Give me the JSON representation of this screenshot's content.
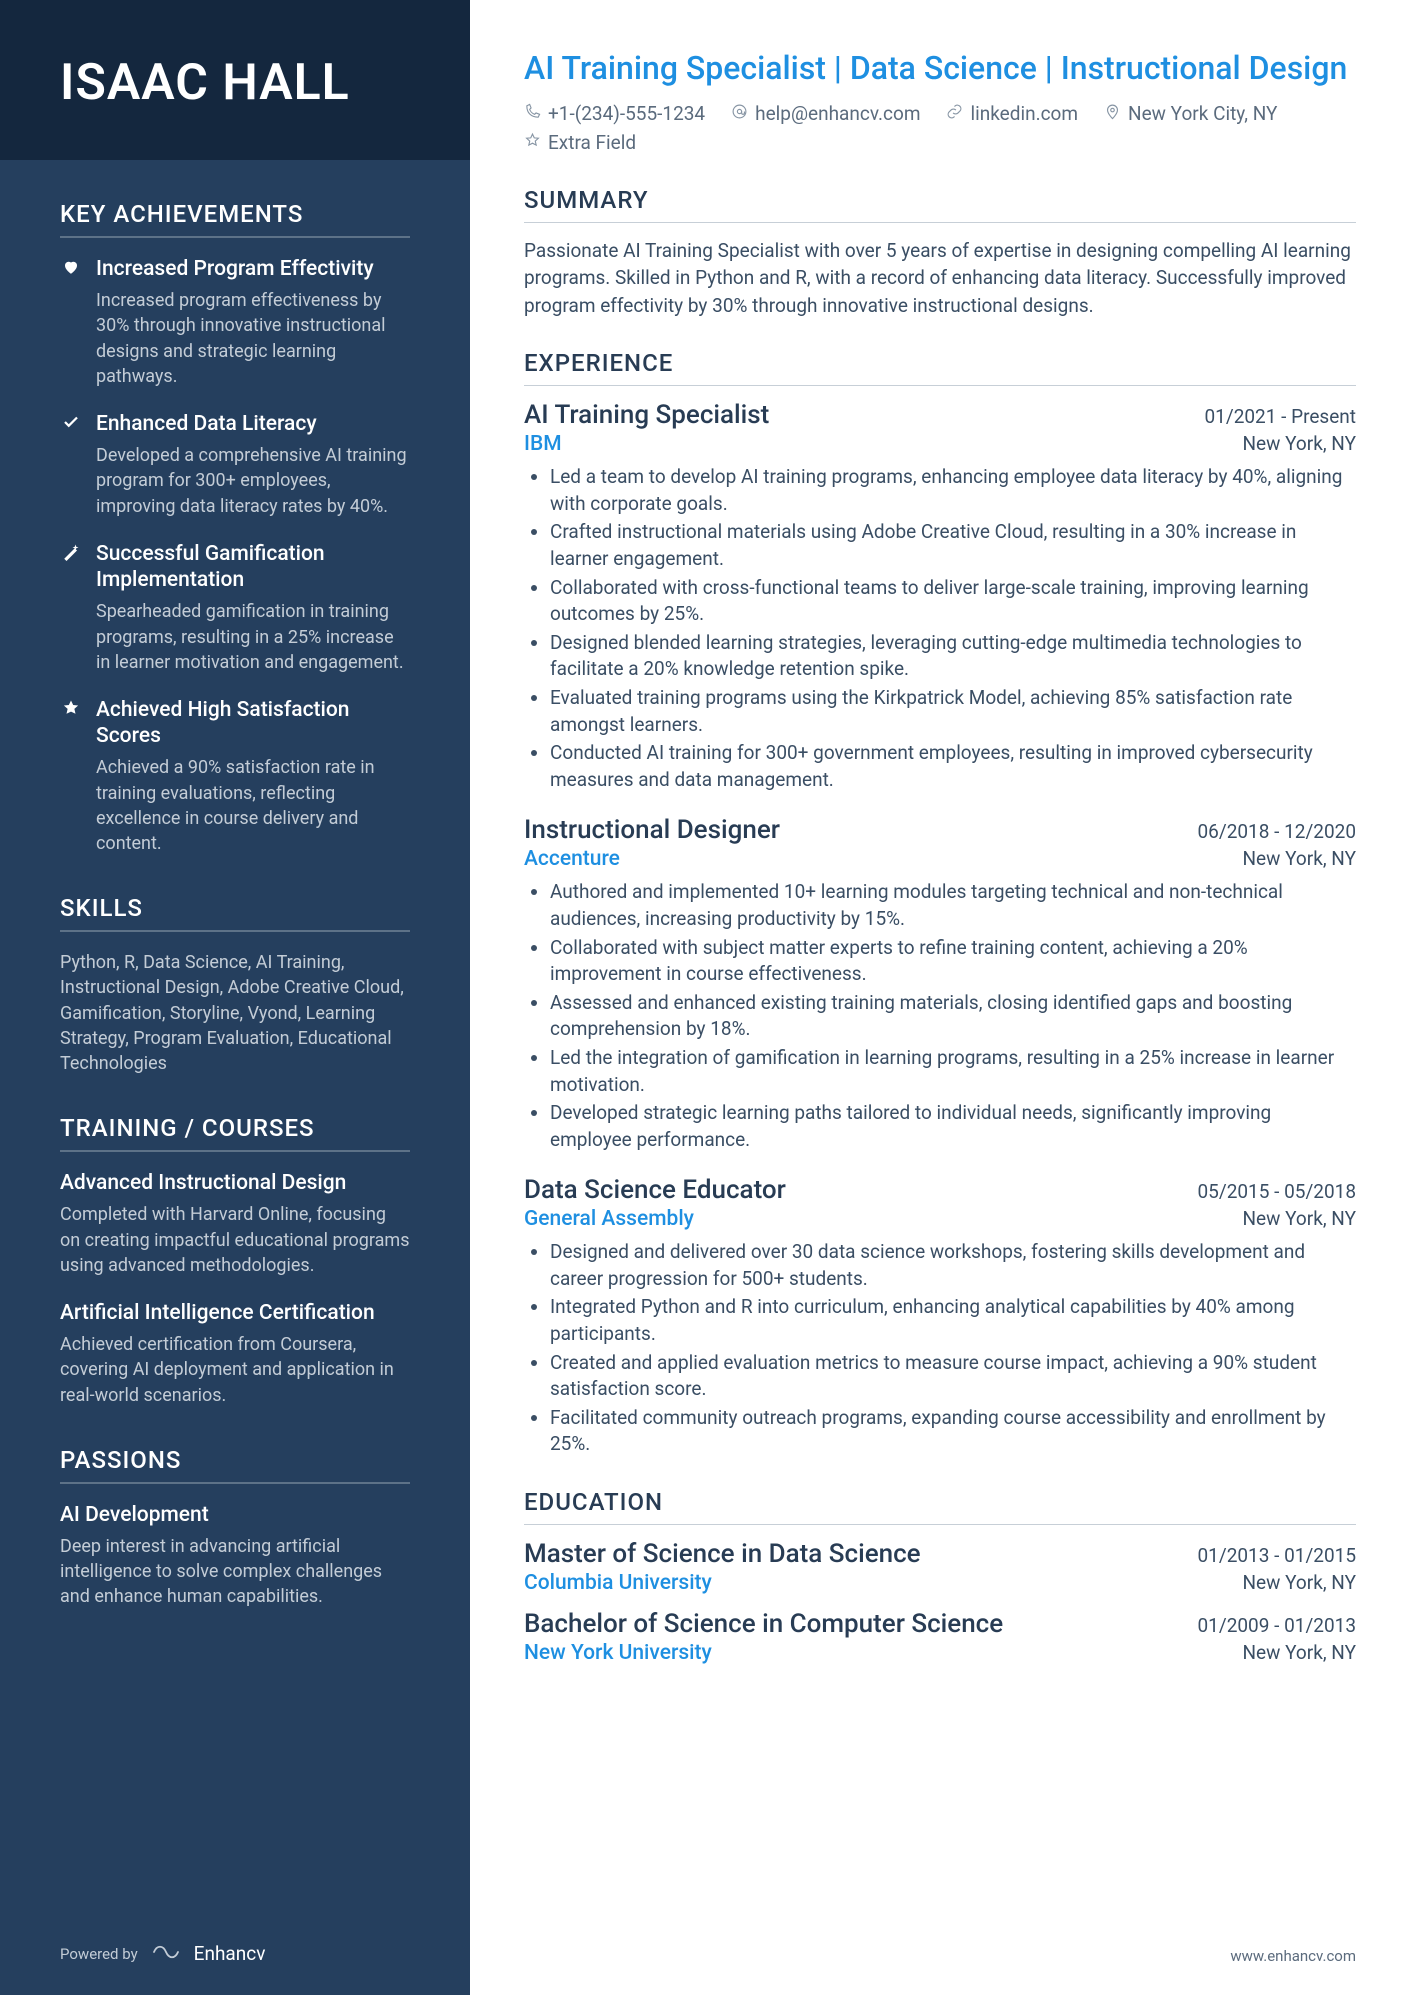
{
  "name": "ISAAC HALL",
  "title": "AI Training Specialist | Data Science | Instructional Design",
  "contact": {
    "phone": "+1-(234)-555-1234",
    "email": "help@enhancv.com",
    "linkedin": "linkedin.com",
    "location": "New York City, NY",
    "extra": "Extra Field"
  },
  "sidebar": {
    "achievements_heading": "KEY ACHIEVEMENTS",
    "achievements": [
      {
        "icon": "heart",
        "title": "Increased Program Effectivity",
        "desc": "Increased program effectiveness by 30% through innovative instructional designs and strategic learning pathways."
      },
      {
        "icon": "check",
        "title": "Enhanced Data Literacy",
        "desc": "Developed a comprehensive AI training program for 300+ employees, improving data literacy rates by 40%."
      },
      {
        "icon": "wand",
        "title": "Successful Gamification Implementation",
        "desc": "Spearheaded gamification in training programs, resulting in a 25% increase in learner motivation and engagement."
      },
      {
        "icon": "star",
        "title": "Achieved High Satisfaction Scores",
        "desc": "Achieved a 90% satisfaction rate in training evaluations, reflecting excellence in course delivery and content."
      }
    ],
    "skills_heading": "SKILLS",
    "skills_text": "Python, R, Data Science, AI Training, Instructional Design, Adobe Creative Cloud, Gamification, Storyline, Vyond, Learning Strategy, Program Evaluation, Educational Technologies",
    "training_heading": "TRAINING / COURSES",
    "courses": [
      {
        "title": "Advanced Instructional Design",
        "desc": "Completed with Harvard Online, focusing on creating impactful educational programs using advanced methodologies."
      },
      {
        "title": "Artificial Intelligence Certification",
        "desc": "Achieved certification from Coursera, covering AI deployment and application in real-world scenarios."
      }
    ],
    "passions_heading": "PASSIONS",
    "passions": [
      {
        "title": "AI Development",
        "desc": "Deep interest in advancing artificial intelligence to solve complex challenges and enhance human capabilities."
      }
    ],
    "powered_by": "Powered by",
    "brand": "Enhancv"
  },
  "main": {
    "summary_heading": "SUMMARY",
    "summary": "Passionate AI Training Specialist with over 5 years of expertise in designing compelling AI learning programs. Skilled in Python and R, with a record of enhancing data literacy. Successfully improved program effectivity by 30% through innovative instructional designs.",
    "experience_heading": "EXPERIENCE",
    "experience": [
      {
        "title": "AI Training Specialist",
        "dates": "01/2021 - Present",
        "company": "IBM",
        "location": "New York, NY",
        "bullets": [
          "Led a team to develop AI training programs, enhancing employee data literacy by 40%, aligning with corporate goals.",
          "Crafted instructional materials using Adobe Creative Cloud, resulting in a 30% increase in learner engagement.",
          "Collaborated with cross-functional teams to deliver large-scale training, improving learning outcomes by 25%.",
          "Designed blended learning strategies, leveraging cutting-edge multimedia technologies to facilitate a 20% knowledge retention spike.",
          "Evaluated training programs using the Kirkpatrick Model, achieving 85% satisfaction rate amongst learners.",
          "Conducted AI training for 300+ government employees, resulting in improved cybersecurity measures and data management."
        ]
      },
      {
        "title": "Instructional Designer",
        "dates": "06/2018 - 12/2020",
        "company": "Accenture",
        "location": "New York, NY",
        "bullets": [
          "Authored and implemented 10+ learning modules targeting technical and non-technical audiences, increasing productivity by 15%.",
          "Collaborated with subject matter experts to refine training content, achieving a 20% improvement in course effectiveness.",
          "Assessed and enhanced existing training materials, closing identified gaps and boosting comprehension by 18%.",
          "Led the integration of gamification in learning programs, resulting in a 25% increase in learner motivation.",
          "Developed strategic learning paths tailored to individual needs, significantly improving employee performance."
        ]
      },
      {
        "title": "Data Science Educator",
        "dates": "05/2015 - 05/2018",
        "company": "General Assembly",
        "location": "New York, NY",
        "bullets": [
          "Designed and delivered over 30 data science workshops, fostering skills development and career progression for 500+ students.",
          "Integrated Python and R into curriculum, enhancing analytical capabilities by 40% among participants.",
          "Created and applied evaluation metrics to measure course impact, achieving a 90% student satisfaction score.",
          "Facilitated community outreach programs, expanding course accessibility and enrollment by 25%."
        ]
      }
    ],
    "education_heading": "EDUCATION",
    "education": [
      {
        "title": "Master of Science in Data Science",
        "dates": "01/2013 - 01/2015",
        "school": "Columbia University",
        "location": "New York, NY"
      },
      {
        "title": "Bachelor of Science in Computer Science",
        "dates": "01/2009 - 01/2013",
        "school": "New York University",
        "location": "New York, NY"
      }
    ],
    "website": "www.enhancv.com"
  }
}
